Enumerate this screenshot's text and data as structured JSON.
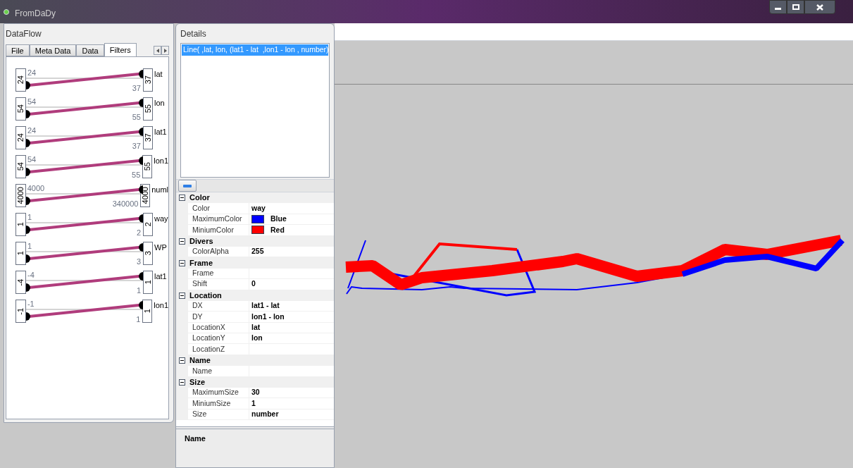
{
  "window": {
    "title": "FromDaDy"
  },
  "dataflow": {
    "title": "DataFlow",
    "tabs": [
      {
        "label": "File",
        "selected": false
      },
      {
        "label": "Meta Data",
        "selected": false
      },
      {
        "label": "Data",
        "selected": false
      },
      {
        "label": "Filters",
        "selected": true
      }
    ],
    "filters": [
      {
        "low": "24",
        "min": "24",
        "max": "37",
        "high": "37",
        "name": "lat"
      },
      {
        "low": "54",
        "min": "54",
        "max": "55",
        "high": "55",
        "name": "lon"
      },
      {
        "low": "24",
        "min": "24",
        "max": "37",
        "high": "37",
        "name": "lat1"
      },
      {
        "low": "54",
        "min": "54",
        "max": "55",
        "high": "55",
        "name": "lon1"
      },
      {
        "low": "4000",
        "min": "4000",
        "max": "340000",
        "high": "4000",
        "name": "numl"
      },
      {
        "low": "1",
        "min": "1",
        "max": "2",
        "high": "2",
        "name": "way"
      },
      {
        "low": "1",
        "min": "1",
        "max": "3",
        "high": "3",
        "name": "WP"
      },
      {
        "low": "-4",
        "min": "-4",
        "max": "1",
        "high": "1",
        "name": "lat1"
      },
      {
        "low": "-1",
        "min": "-1",
        "max": "1",
        "high": "1",
        "name": "lon1"
      }
    ]
  },
  "details": {
    "title": "Details",
    "items": [
      {
        "label": "Line( ,lat, lon, (lat1 - lat  ,lon1 - lon , number)",
        "selected": true
      }
    ],
    "categories": [
      {
        "name": "Color",
        "expanded": true,
        "properties": [
          {
            "name": "Color",
            "value": "way"
          },
          {
            "name": "MaximumColor",
            "value": "Blue",
            "color": "#0000ff"
          },
          {
            "name": "MiniumColor",
            "value": "Red",
            "color": "#ff0000"
          }
        ]
      },
      {
        "name": "Divers",
        "expanded": true,
        "properties": [
          {
            "name": "ColorAlpha",
            "value": "255"
          }
        ]
      },
      {
        "name": "Frame",
        "expanded": true,
        "properties": [
          {
            "name": "Frame"
          },
          {
            "name": "Shift",
            "value": "0"
          }
        ]
      },
      {
        "name": "Location",
        "expanded": true,
        "properties": [
          {
            "name": "DX",
            "value": "lat1 - lat"
          },
          {
            "name": "DY",
            "value": "lon1 - lon"
          },
          {
            "name": "LocationX",
            "value": "lat"
          },
          {
            "name": "LocationY",
            "value": "lon"
          },
          {
            "name": "LocationZ"
          }
        ]
      },
      {
        "name": "Name",
        "expanded": true,
        "properties": [
          {
            "name": "Name"
          }
        ]
      },
      {
        "name": "Size",
        "expanded": true,
        "properties": [
          {
            "name": "MaximumSize",
            "value": "30"
          },
          {
            "name": "MiniumSize",
            "value": "1"
          },
          {
            "name": "Size",
            "value": "number"
          }
        ]
      }
    ],
    "description": {
      "title": "Name"
    }
  }
}
